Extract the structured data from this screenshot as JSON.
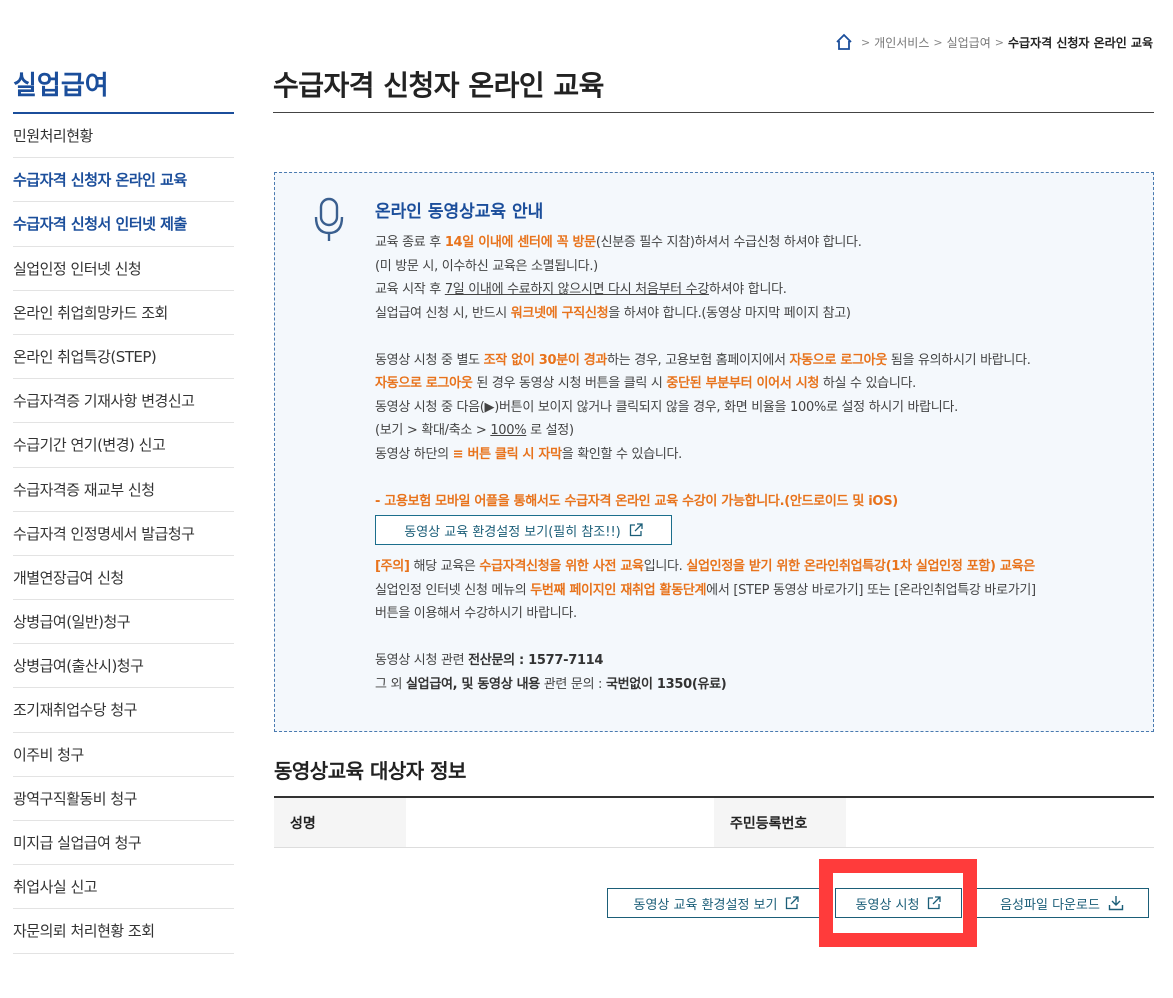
{
  "breadcrumb": {
    "items": [
      "개인서비스",
      "실업급여"
    ],
    "current": "수급자격 신청자 온라인 교육"
  },
  "sidebar": {
    "title": "실업급여",
    "items": [
      {
        "label": "민원처리현황"
      },
      {
        "label": "수급자격 신청자 온라인 교육"
      },
      {
        "label": "수급자격 신청서 인터넷 제출"
      },
      {
        "label": "실업인정 인터넷 신청"
      },
      {
        "label": "온라인 취업희망카드 조회"
      },
      {
        "label": "온라인 취업특강(STEP)"
      },
      {
        "label": "수급자격증 기재사항 변경신고"
      },
      {
        "label": "수급기간 연기(변경) 신고"
      },
      {
        "label": "수급자격증 재교부 신청"
      },
      {
        "label": "수급자격 인정명세서 발급청구"
      },
      {
        "label": "개별연장급여 신청"
      },
      {
        "label": "상병급여(일반)청구"
      },
      {
        "label": "상병급여(출산시)청구"
      },
      {
        "label": "조기재취업수당 청구"
      },
      {
        "label": "이주비 청구"
      },
      {
        "label": "광역구직활동비 청구"
      },
      {
        "label": "미지급 실업급여 청구"
      },
      {
        "label": "취업사실 신고"
      },
      {
        "label": "자문의뢰 처리현황 조회"
      }
    ]
  },
  "page_title": "수급자격 신청자 온라인 교육",
  "info": {
    "title": "온라인 동영상교육 안내",
    "l1a": "교육 종료 후 ",
    "l1b": "14일 이내에 센터에 꼭 방문",
    "l1c": "(신분증 필수 지참)하셔서 수급신청 하셔야 합니다.",
    "l2": "(미 방문 시, 이수하신 교육은 소멸됩니다.)",
    "l3a": "교육 시작 후 ",
    "l3b": "7일 이내에 수료하지 않으시면 다시 처음부터 수강",
    "l3c": "하셔야 합니다.",
    "l4a": "실업급여 신청 시, 반드시 ",
    "l4b": "워크넷에 구직신청",
    "l4c": "을 하셔야 합니다.(동영상 마지막 페이지 참고)",
    "l5a": "동영상 시청 중 별도 ",
    "l5b": "조작 없이 30분이 경과",
    "l5c": "하는 경우, 고용보험 홈페이지에서 ",
    "l5d": "자동으로 로그아웃",
    "l5e": " 됨을 유의하시기 바랍니다.",
    "l6a": "자동으로 로그아웃",
    "l6b": " 된 경우 동영상 시청 버튼을 클릭 시 ",
    "l6c": "중단된 부분부터 이어서 시청",
    "l6d": " 하실 수 있습니다.",
    "l7": "동영상 시청 중 다음(▶)버튼이 보이지 않거나 클릭되지 않을 경우, 화면 비율을 100%로 설정 하시기 바랍니다.",
    "l8a": "(보기 > 확대/축소 > ",
    "l8b": "100%",
    "l8c": " 로 설정)",
    "l9a": "동영상 하단의 ",
    "l9b": "≡ 버튼 클릭 시 자막",
    "l9c": "을 확인할 수 있습니다.",
    "l10": "- 고용보험 모바일 어플을 통해서도 수급자격 온라인 교육 수강이 가능합니다.(안드로이드 및 iOS)",
    "env_btn": "동영상 교육 환경설정 보기(필히 참조!!)",
    "l11a": "[주의]",
    "l11b": " 해당 교육은 ",
    "l11c": "수급자격신청을 위한 사전 교육",
    "l11d": "입니다. ",
    "l11e": "실업인정을 받기 위한 온라인취업특강(1차 실업인정 포함) 교육은",
    "l12a": "실업인정 인터넷 신청 메뉴의 ",
    "l12b": "두번째 페이지인 재취업 활동단계",
    "l12c": "에서 [STEP 동영상 바로가기] 또는 [온라인취업특강 바로가기]",
    "l13": "버튼을 이용해서 수강하시기 바랍니다.",
    "l14a": "동영상 시청 관련 ",
    "l14b": "전산문의 : 1577-7114",
    "l15a": "그 외 ",
    "l15b": "실업급여, 및 동영상 내용",
    "l15c": " 관련 문의 : ",
    "l15d": "국번없이 1350(유료)"
  },
  "section_title": "동영상교육 대상자 정보",
  "table": {
    "name_label": "성명",
    "name_value": "",
    "id_label": "주민등록번호",
    "id_value": ""
  },
  "buttons": {
    "env": "동영상 교육 환경설정 보기",
    "watch": "동영상 시청",
    "download": "음성파일 다운로드"
  }
}
